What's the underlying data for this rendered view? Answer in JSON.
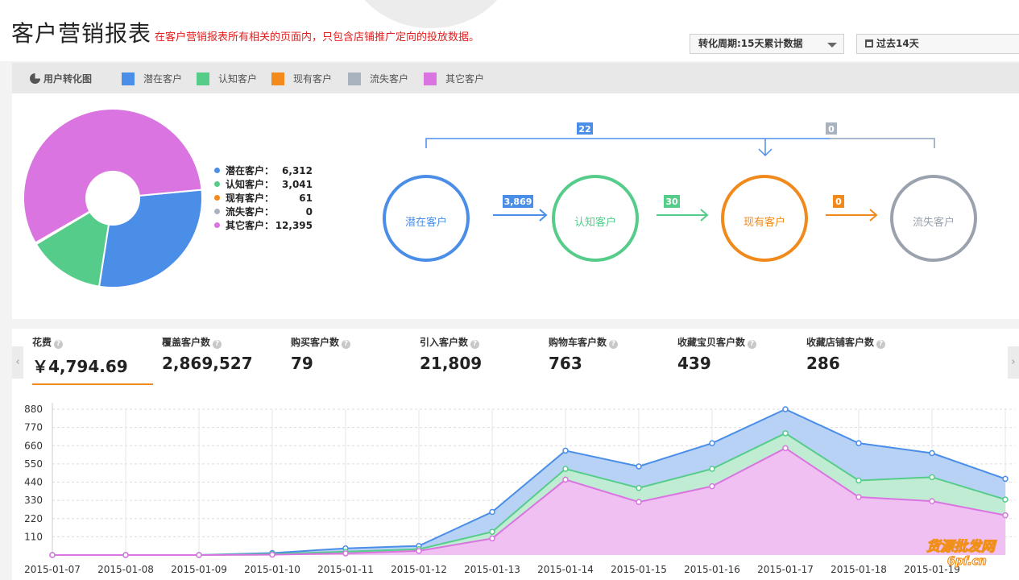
{
  "header": {
    "title": "客户营销报表",
    "note": "在客户营销报表所有相关的页面内，只包含店铺推广定向的投放数据。",
    "period_select": "转化周期:15天累计数据",
    "date_select": "过去14天"
  },
  "legend_bar": {
    "title": "用户转化图",
    "items": [
      {
        "label": "潜在客户",
        "color": "#4a8ee8"
      },
      {
        "label": "认知客户",
        "color": "#56cc8a"
      },
      {
        "label": "现有客户",
        "color": "#f58a1c"
      },
      {
        "label": "流失客户",
        "color": "#a9b3c0"
      },
      {
        "label": "其它客户",
        "color": "#d974e0"
      }
    ]
  },
  "pie": {
    "rows": [
      {
        "label": "潜在客户：",
        "value": "6,312",
        "num": 6312,
        "color": "#4a8ee8"
      },
      {
        "label": "认知客户：",
        "value": "3,041",
        "num": 3041,
        "color": "#56cc8a"
      },
      {
        "label": "现有客户：",
        "value": "61",
        "num": 61,
        "color": "#f58a1c"
      },
      {
        "label": "流失客户：",
        "value": "0",
        "num": 0,
        "color": "#a9b3c0"
      },
      {
        "label": "其它客户：",
        "value": "12,395",
        "num": 12395,
        "color": "#d974e0"
      }
    ]
  },
  "flow": {
    "nodes": [
      {
        "label": "潜在客户",
        "color": "#4a8ee8"
      },
      {
        "label": "认知客户",
        "color": "#56cc8a"
      },
      {
        "label": "现有客户",
        "color": "#f08a1c"
      },
      {
        "label": "流失客户",
        "color": "#9aa3ad"
      }
    ],
    "links": [
      {
        "value": "3,869",
        "color": "#4a8ee8"
      },
      {
        "value": "30",
        "color": "#56cc8a"
      },
      {
        "value": "0",
        "color": "#f08a1c"
      }
    ],
    "top_left_value": "22",
    "top_right_value": "0"
  },
  "metrics": [
    {
      "label": "花费",
      "value": "￥4,794.69",
      "active": true
    },
    {
      "label": "覆盖客户数",
      "value": "2,869,527"
    },
    {
      "label": "购买客户数",
      "value": "79"
    },
    {
      "label": "引入客户数",
      "value": "21,809"
    },
    {
      "label": "购物车客户数",
      "value": "763"
    },
    {
      "label": "收藏宝贝客户数",
      "value": "439"
    },
    {
      "label": "收藏店铺客户数",
      "value": "286"
    }
  ],
  "chart_data": {
    "type": "area",
    "categories": [
      "2015-01-07",
      "2015-01-08",
      "2015-01-09",
      "2015-01-10",
      "2015-01-11",
      "2015-01-12",
      "2015-01-13",
      "2015-01-14",
      "2015-01-15",
      "2015-01-16",
      "2015-01-17",
      "2015-01-18",
      "2015-01-19"
    ],
    "ylim": [
      0,
      880
    ],
    "yticks": [
      110,
      220,
      330,
      440,
      550,
      660,
      770,
      880
    ],
    "grid": true,
    "series": [
      {
        "color": "#4a8ee8",
        "fill": "#b8d2f5",
        "values": [
          0,
          0,
          0,
          12,
          40,
          55,
          260,
          630,
          535,
          675,
          880,
          675,
          615,
          460
        ]
      },
      {
        "color": "#56cc8a",
        "fill": "#bfecd2",
        "values": [
          0,
          0,
          0,
          6,
          20,
          35,
          140,
          520,
          405,
          520,
          735,
          450,
          470,
          335
        ]
      },
      {
        "color": "#d974e0",
        "fill": "#efc0f1",
        "values": [
          0,
          0,
          0,
          2,
          10,
          25,
          100,
          455,
          320,
          415,
          645,
          350,
          325,
          240
        ]
      }
    ]
  },
  "watermark": {
    "main": "货源批发网",
    "sub": "6pf.cn"
  }
}
